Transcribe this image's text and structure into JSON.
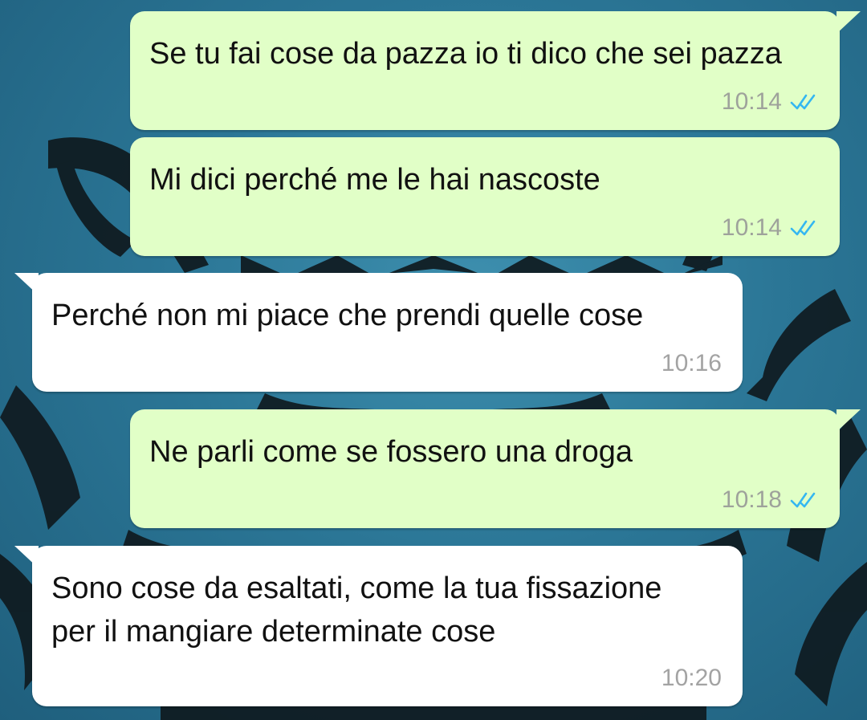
{
  "colors": {
    "outgoing_bubble": "#e1ffc7",
    "incoming_bubble": "#ffffff",
    "read_ticks": "#34b7f1",
    "wallpaper": "#2b7696"
  },
  "messages": [
    {
      "direction": "outgoing",
      "text": "Se tu fai cose da pazza io ti dico che sei pazza",
      "time": "10:14",
      "status": "read-double-check-icon"
    },
    {
      "direction": "outgoing",
      "text": "Mi dici perché me le hai nascoste",
      "time": "10:14",
      "status": "read-double-check-icon"
    },
    {
      "direction": "incoming",
      "text": "Perché non mi piace che prendi quelle cose",
      "time": "10:16"
    },
    {
      "direction": "outgoing",
      "text": "Ne parli come se fossero una droga",
      "time": "10:18",
      "status": "read-double-check-icon"
    },
    {
      "direction": "incoming",
      "text": "Sono cose da esaltati, come la tua fissazione per il mangiare determinate cose",
      "time": "10:20"
    }
  ]
}
